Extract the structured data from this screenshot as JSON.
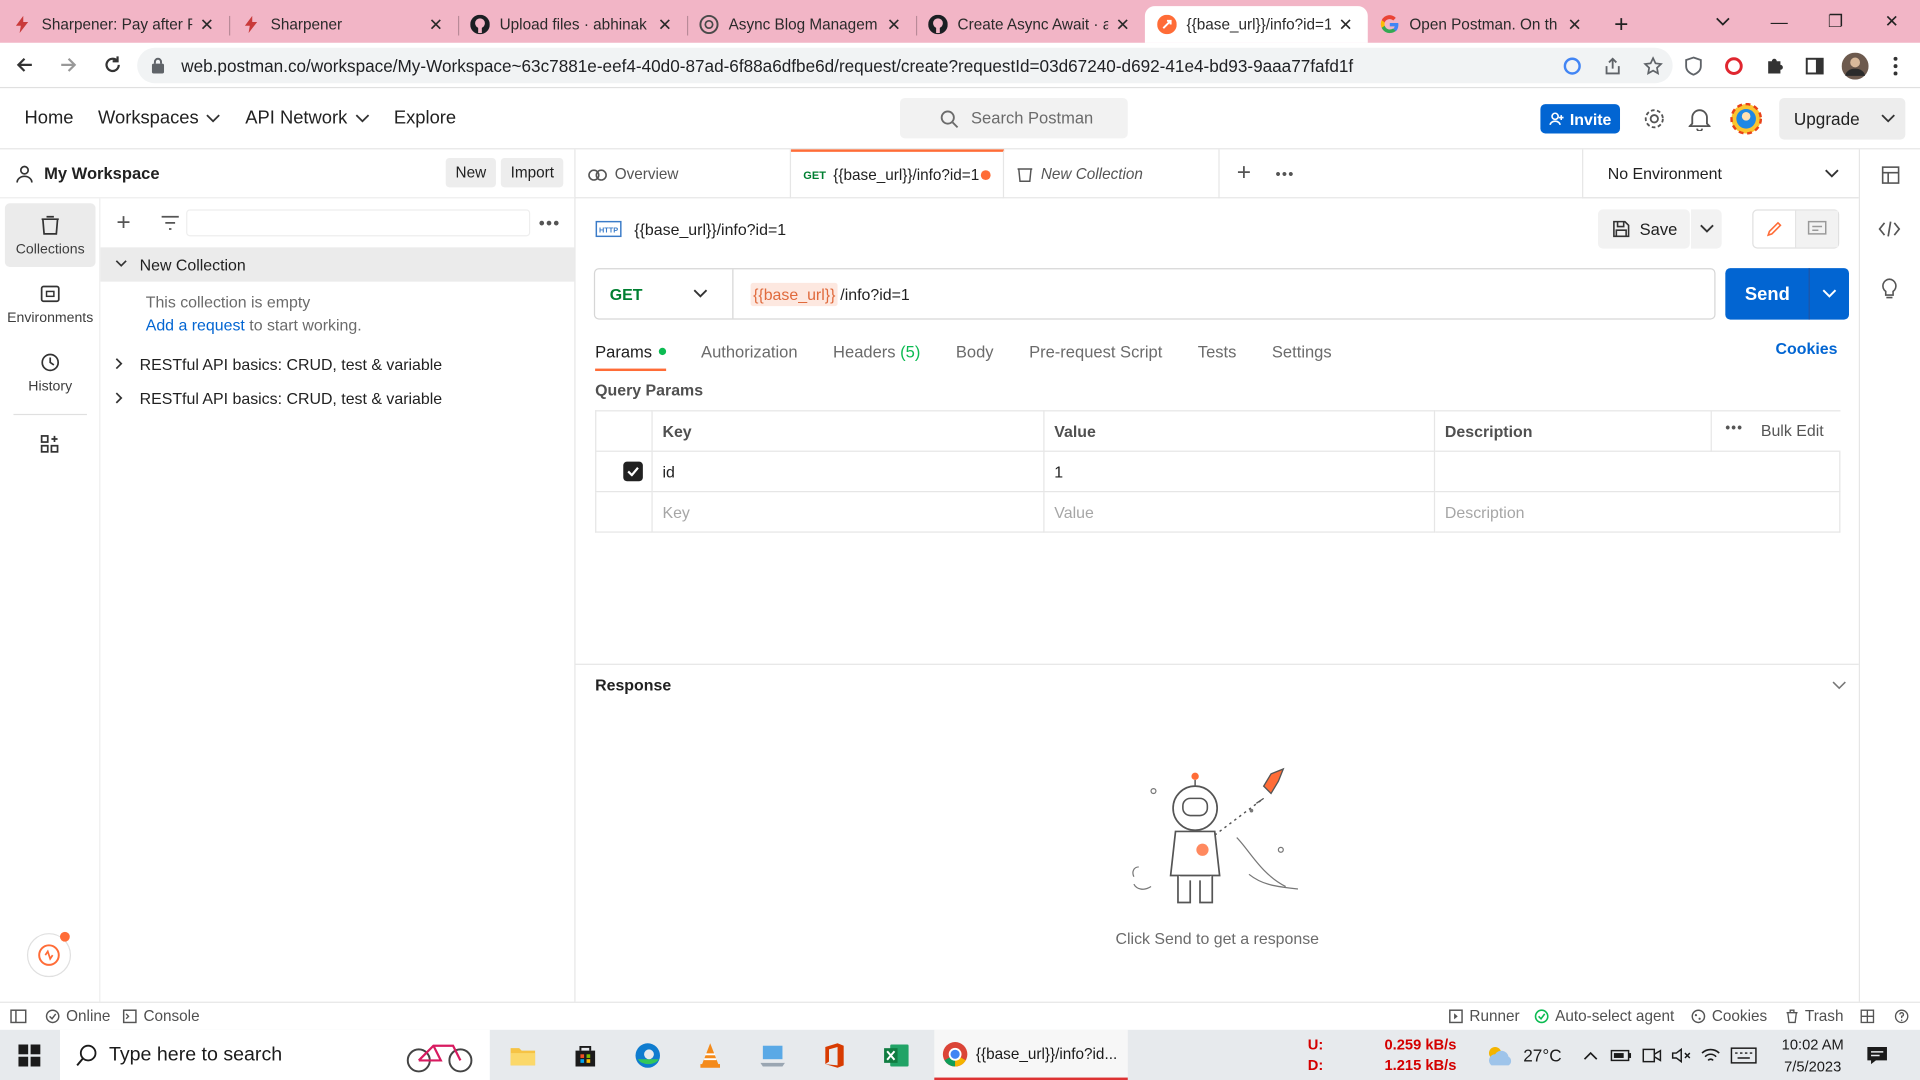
{
  "browser": {
    "tabs": [
      {
        "title": "Sharpener: Pay after P",
        "icon": "sharpener-bolt-icon",
        "active": false
      },
      {
        "title": "Sharpener",
        "icon": "sharpener-bolt-icon",
        "active": false
      },
      {
        "title": "Upload files · abhinak",
        "icon": "github-icon",
        "active": false
      },
      {
        "title": "Async Blog Managem",
        "icon": "openai-icon",
        "active": false
      },
      {
        "title": "Create Async Await · a",
        "icon": "github-icon",
        "active": false
      },
      {
        "title": "{{base_url}}/info?id=1",
        "icon": "postman-icon",
        "active": true
      },
      {
        "title": "Open Postman. On th",
        "icon": "google-icon",
        "active": false
      }
    ],
    "url": "web.postman.co/workspace/My-Workspace~63c7881e-eef4-40d0-87ad-6f88a6dfbe6d/request/create?requestId=03d67240-d692-41e4-bd93-9aaa77fafd1f"
  },
  "postman": {
    "nav": {
      "home": "Home",
      "workspaces": "Workspaces",
      "api_network": "API Network",
      "explore": "Explore"
    },
    "search_placeholder": "Search Postman",
    "invite_label": "Invite",
    "upgrade_label": "Upgrade",
    "workspace_name": "My Workspace",
    "new_label": "New",
    "import_label": "Import",
    "rail": [
      {
        "label": "Collections",
        "icon": "collections-icon"
      },
      {
        "label": "Environments",
        "icon": "environments-icon"
      },
      {
        "label": "History",
        "icon": "history-icon"
      }
    ],
    "tree": {
      "collection_name": "New Collection",
      "empty_text": "This collection is empty",
      "add_link": "Add a request",
      "add_suffix": " to start working.",
      "items": [
        "RESTful API basics: CRUD, test & variable",
        "RESTful API basics: CRUD, test & variable"
      ]
    },
    "workspace_tabs": {
      "overview": "Overview",
      "request_method": "GET",
      "request_title": "{{base_url}}/info?id=1",
      "collection": "New Collection"
    },
    "environment": "No Environment",
    "request": {
      "title": "{{base_url}}/info?id=1",
      "save_label": "Save",
      "method": "GET",
      "url_var": "{{base_url}}",
      "url_path": "/info?id=1",
      "send_label": "Send",
      "tabs": [
        "Params",
        "Authorization",
        "Headers",
        "Body",
        "Pre-request Script",
        "Tests",
        "Settings"
      ],
      "headers_count": "(5)",
      "cookies_label": "Cookies",
      "query_params_label": "Query Params",
      "table": {
        "headers": [
          "Key",
          "Value",
          "Description"
        ],
        "bulk_edit": "Bulk Edit",
        "rows": [
          {
            "key": "id",
            "value": "1",
            "description": ""
          }
        ],
        "placeholders": {
          "key": "Key",
          "value": "Value",
          "description": "Description"
        }
      }
    },
    "response": {
      "title": "Response",
      "hint": "Click Send to get a response"
    },
    "status_bar": {
      "online": "Online",
      "console": "Console",
      "runner": "Runner",
      "agent": "Auto-select agent",
      "cookies": "Cookies",
      "trash": "Trash"
    }
  },
  "taskbar": {
    "search_placeholder": "Type here to search",
    "chrome_label": "{{base_url}}/info?id...",
    "net_up_label": "U:",
    "net_up": "0.259 kB/s",
    "net_down_label": "D:",
    "net_down": "1.215 kB/s",
    "weather": "27°C",
    "time": "10:02 AM",
    "date": "7/5/2023"
  },
  "colors": {
    "postman_orange": "#ff6c37",
    "send_blue": "#0265d2",
    "get_green": "#007f31",
    "tabstrip_pink": "#f2b5c6"
  }
}
